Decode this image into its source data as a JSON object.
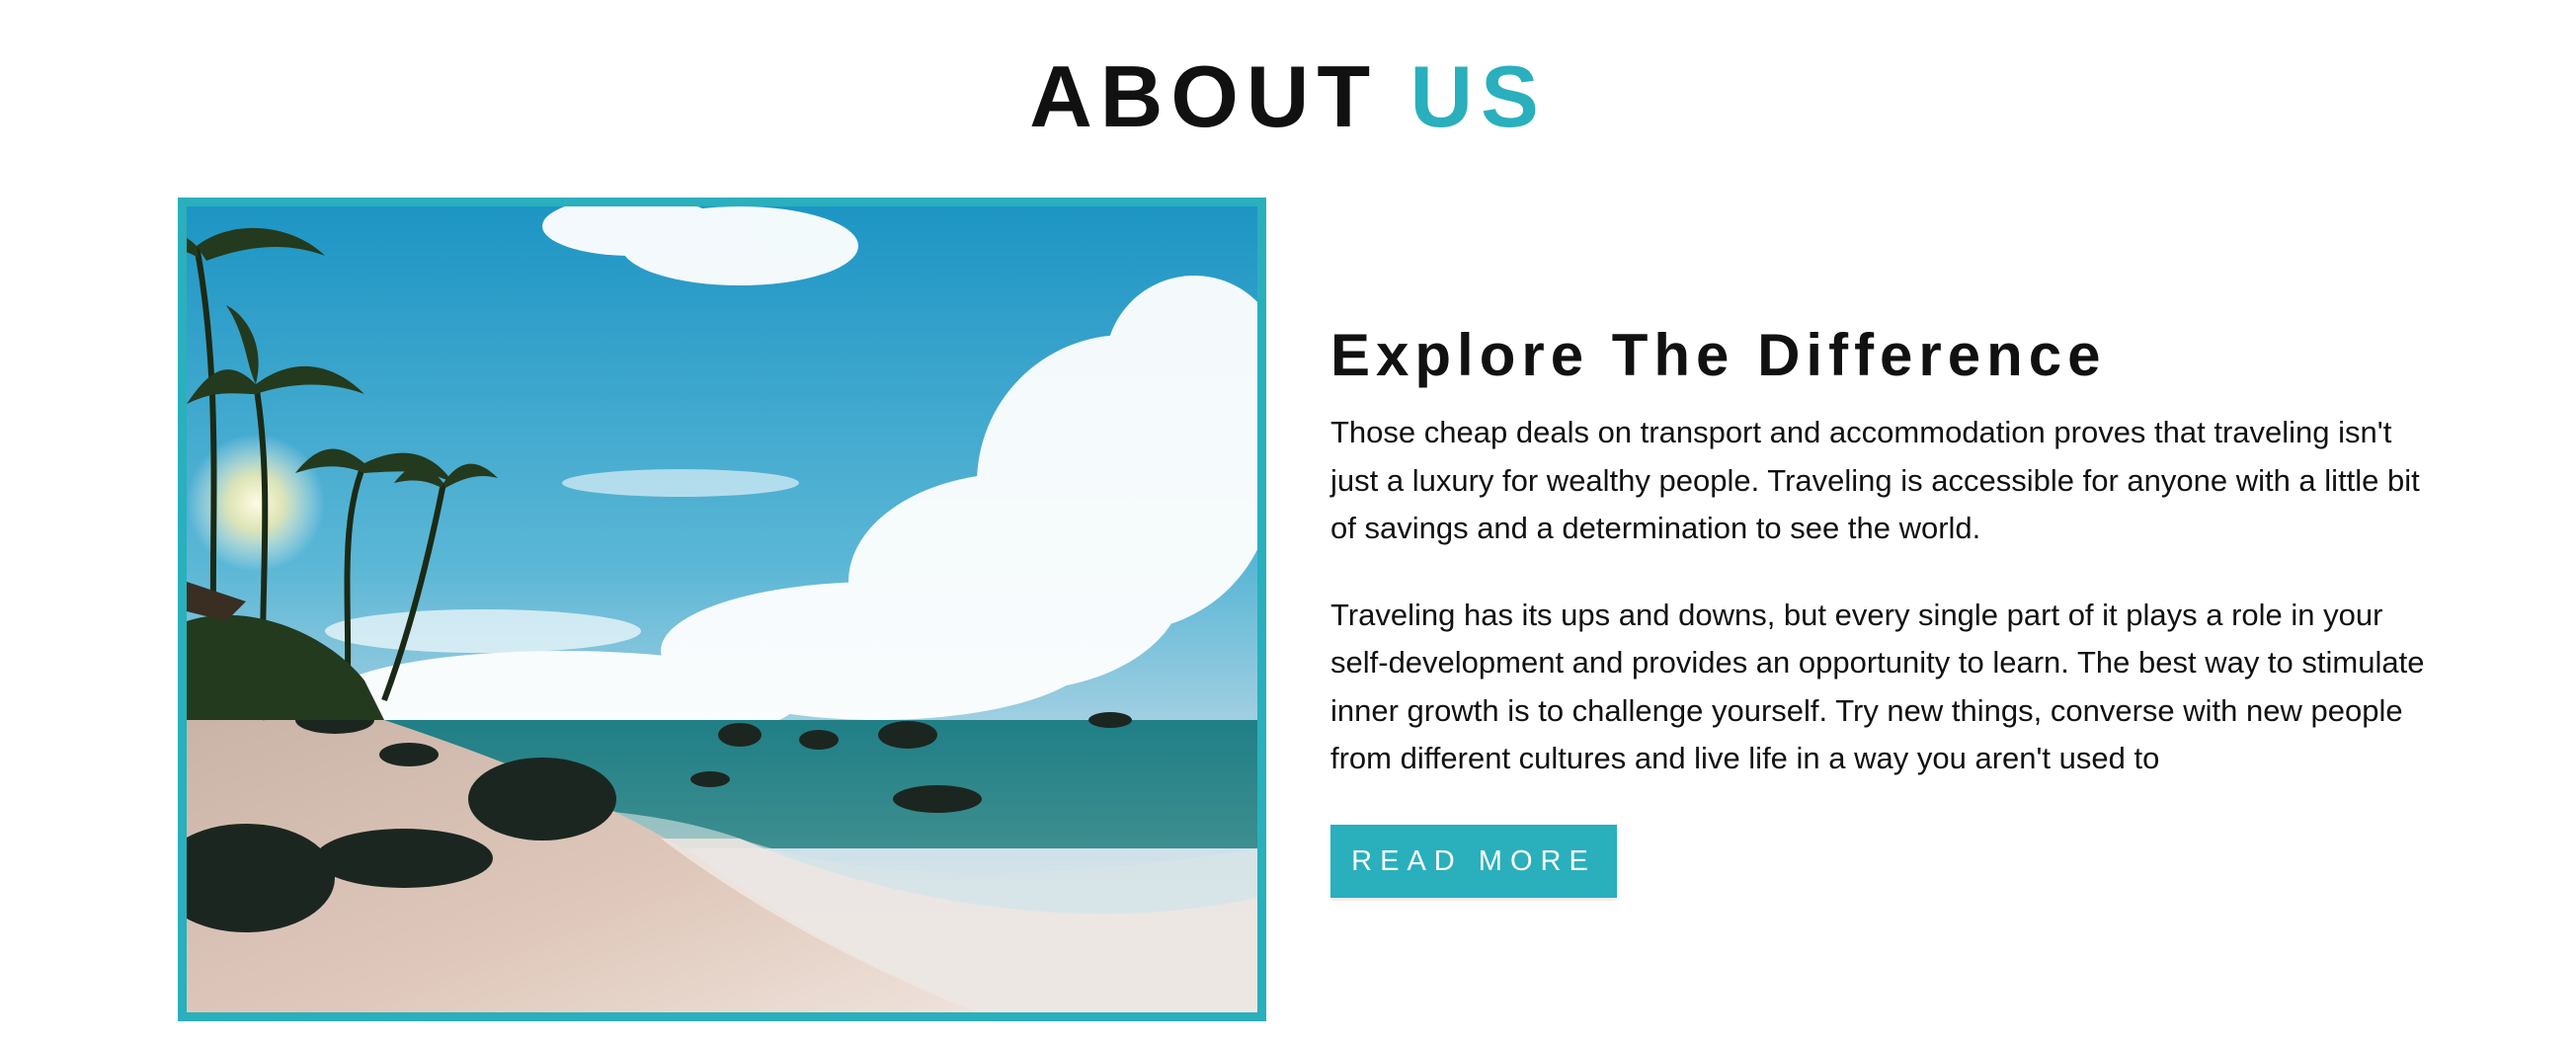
{
  "section_title": {
    "main": "ABOUT",
    "accent": "US"
  },
  "colors": {
    "accent": "#2aafbd",
    "text": "#111111",
    "background": "#ffffff"
  },
  "image": {
    "icon": "beach-photo",
    "subject": "beach-with-palm-trees-and-rocks"
  },
  "content": {
    "heading": "Explore The Difference",
    "paragraph_1": "Those cheap deals on transport and accommodation proves that traveling isn't just a luxury for wealthy people. Traveling is accessible for anyone with a little bit of savings and a determination to see the world.",
    "paragraph_2": "Traveling has its ups and downs, but every single part of it plays a role in your self-development and provides an opportunity to learn. The best way to stimulate inner growth is to challenge yourself. Try new things, converse with new people from different cultures and live life in a way you aren't used to",
    "button_label": "READ MORE"
  }
}
